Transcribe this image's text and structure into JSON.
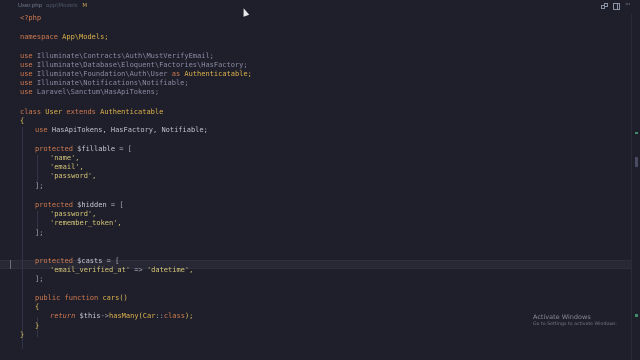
{
  "tab": {
    "filename": "User.php",
    "path": "app\\Models",
    "modified": "M"
  },
  "icons": [
    "compare-icon",
    "split-editor-icon",
    "more-actions-icon"
  ],
  "code": {
    "open_tag": "<?php",
    "ns_kw": "namespace",
    "ns_name": "App\\Models;",
    "uses": [
      {
        "kw": "use",
        "path": "Illuminate\\Contracts\\Auth\\MustVerifyEmail;",
        "alias_kw": "",
        "alias": ""
      },
      {
        "kw": "use",
        "path": "Illuminate\\Database\\Eloquent\\Factories\\HasFactory;",
        "alias_kw": "",
        "alias": ""
      },
      {
        "kw": "use",
        "path": "Illuminate\\Foundation\\Auth\\User",
        "alias_kw": "as",
        "alias": "Authenticatable;"
      },
      {
        "kw": "use",
        "path": "Illuminate\\Notifications\\Notifiable;",
        "alias_kw": "",
        "alias": ""
      },
      {
        "kw": "use",
        "path": "Laravel\\Sanctum\\HasApiTokens;",
        "alias_kw": "",
        "alias": ""
      }
    ],
    "class_kw": "class",
    "class_name": "User",
    "extends_kw": "extends",
    "parent": "Authenticatable",
    "open_brace": "{",
    "close_brace": "}",
    "traits_kw": "use",
    "traits": "HasApiTokens, HasFactory, Notifiable;",
    "fillable_kw": "protected",
    "fillable_var": "$fillable",
    "fillable_assign": " = [",
    "fillable_items": [
      "'name',",
      "'email',",
      "'password',"
    ],
    "array_close": "];",
    "hidden_kw": "protected",
    "hidden_var": "$hidden",
    "hidden_assign": " = [",
    "hidden_items": [
      "'password',",
      "'remember_token',"
    ],
    "casts_kw": "protected",
    "casts_var": "$casts",
    "casts_assign": " = [",
    "casts_key": "'email_verified_at'",
    "casts_arrow": " => ",
    "casts_val": "'datetime',",
    "method_kw1": "public",
    "method_kw2": "function",
    "method_name": "cars",
    "method_parens": "()",
    "return_kw": "return",
    "return_this": "$this",
    "return_arrow": "->",
    "return_fn": "hasMany",
    "return_open": "(",
    "return_cls": "Car",
    "return_sep": "::",
    "return_const": "class",
    "return_close": ");"
  },
  "watermark": {
    "title": "Activate Windows",
    "subtitle": "Go to Settings to activate Windows."
  },
  "colors": {
    "background": "#1f1f2b",
    "keyword": "#d6a35b",
    "string": "#d9c878",
    "class": "#e0b44a"
  }
}
